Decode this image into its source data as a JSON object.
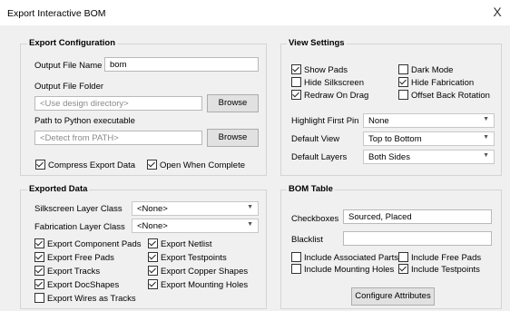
{
  "window": {
    "title": "Export Interactive BOM",
    "close_glyph": "X"
  },
  "export_config": {
    "title": "Export Configuration",
    "output_file_name_label": "Output File Name",
    "output_file_name_value": "bom",
    "output_folder_label": "Output File Folder",
    "output_folder_placeholder": "<Use design directory>",
    "browse_label": "Browse",
    "python_path_label": "Path to Python executable",
    "python_path_placeholder": "<Detect from PATH>",
    "browse2_label": "Browse",
    "compress": {
      "label": "Compress Export Data",
      "checked": true
    },
    "open_when_complete": {
      "label": "Open When Complete",
      "checked": true
    }
  },
  "view_settings": {
    "title": "View Settings",
    "checkboxes": [
      {
        "label": "Show Pads",
        "checked": true
      },
      {
        "label": "Dark Mode",
        "checked": false
      },
      {
        "label": "Hide Silkscreen",
        "checked": false
      },
      {
        "label": "Hide Fabrication",
        "checked": true
      },
      {
        "label": "Redraw On Drag",
        "checked": true
      },
      {
        "label": "Offset Back Rotation",
        "checked": false
      }
    ],
    "highlight_first_pin_label": "Highlight First Pin",
    "highlight_first_pin_value": "None",
    "default_view_label": "Default View",
    "default_view_value": "Top to Bottom",
    "default_layers_label": "Default Layers",
    "default_layers_value": "Both Sides"
  },
  "exported_data": {
    "title": "Exported Data",
    "silkscreen_label": "Silkscreen Layer Class",
    "silkscreen_value": "<None>",
    "fabrication_label": "Fabrication Layer Class",
    "fabrication_value": "<None>",
    "checkboxes": [
      {
        "label": "Export Component Pads",
        "checked": true
      },
      {
        "label": "Export Netlist",
        "checked": true
      },
      {
        "label": "Export Free Pads",
        "checked": true
      },
      {
        "label": "Export Testpoints",
        "checked": true
      },
      {
        "label": "Export Tracks",
        "checked": true
      },
      {
        "label": "Export Copper Shapes",
        "checked": true
      },
      {
        "label": "Export DocShapes",
        "checked": true
      },
      {
        "label": "Export Mounting Holes",
        "checked": true
      },
      {
        "label": "Export Wires as Tracks",
        "checked": false
      }
    ]
  },
  "bom_table": {
    "title": "BOM Table",
    "checkboxes_label": "Checkboxes",
    "checkboxes_value": "Sourced, Placed",
    "blacklist_label": "Blacklist",
    "blacklist_value": "",
    "options": [
      {
        "label": "Include Associated Parts",
        "checked": false
      },
      {
        "label": "Include Free Pads",
        "checked": false
      },
      {
        "label": "Include Mounting Holes",
        "checked": false
      },
      {
        "label": "Include Testpoints",
        "checked": true
      }
    ],
    "configure_label": "Configure Attributes"
  }
}
